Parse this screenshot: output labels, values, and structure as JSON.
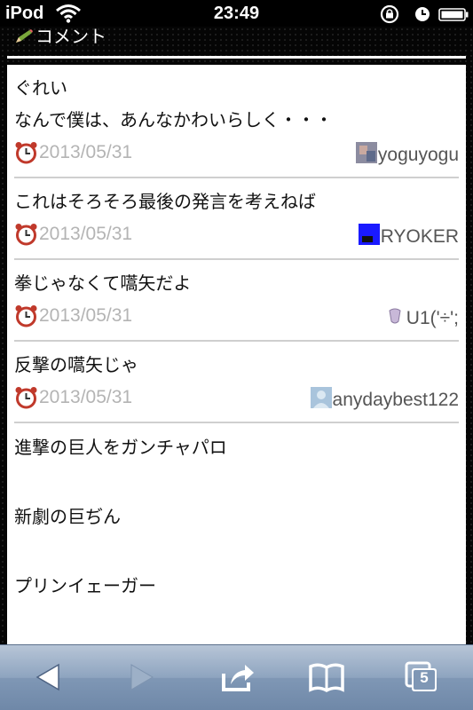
{
  "status_bar": {
    "carrier": "iPod",
    "time": "23:49"
  },
  "section": {
    "title": "コメント"
  },
  "comments": [
    {
      "lines": [
        "ぐれい",
        "なんで僕は、あんなかわいらしく・・・"
      ],
      "date": "2013/05/31",
      "user": "yoguyogu"
    },
    {
      "lines": [
        "これはそろそろ最後の発言を考えねば"
      ],
      "date": "2013/05/31",
      "user": "RYOKER"
    },
    {
      "lines": [
        "拳じゃなくて嚆矢だよ"
      ],
      "date": "2013/05/31",
      "user": "U1('÷';"
    },
    {
      "lines": [
        "反撃の嚆矢じゃ"
      ],
      "date": "2013/05/31",
      "user": "anydaybest122"
    }
  ],
  "last_comment": {
    "lines": [
      "進撃の巨人をガンチャパロ",
      "",
      "新劇の巨ぢん",
      "",
      "プリンイェーガー"
    ]
  },
  "toolbar": {
    "tab_count": "5"
  },
  "colors": {
    "date_text": "#b4b4b4",
    "toolbar_top": "#b7c5d7",
    "toolbar_bottom": "#6f88a8"
  }
}
